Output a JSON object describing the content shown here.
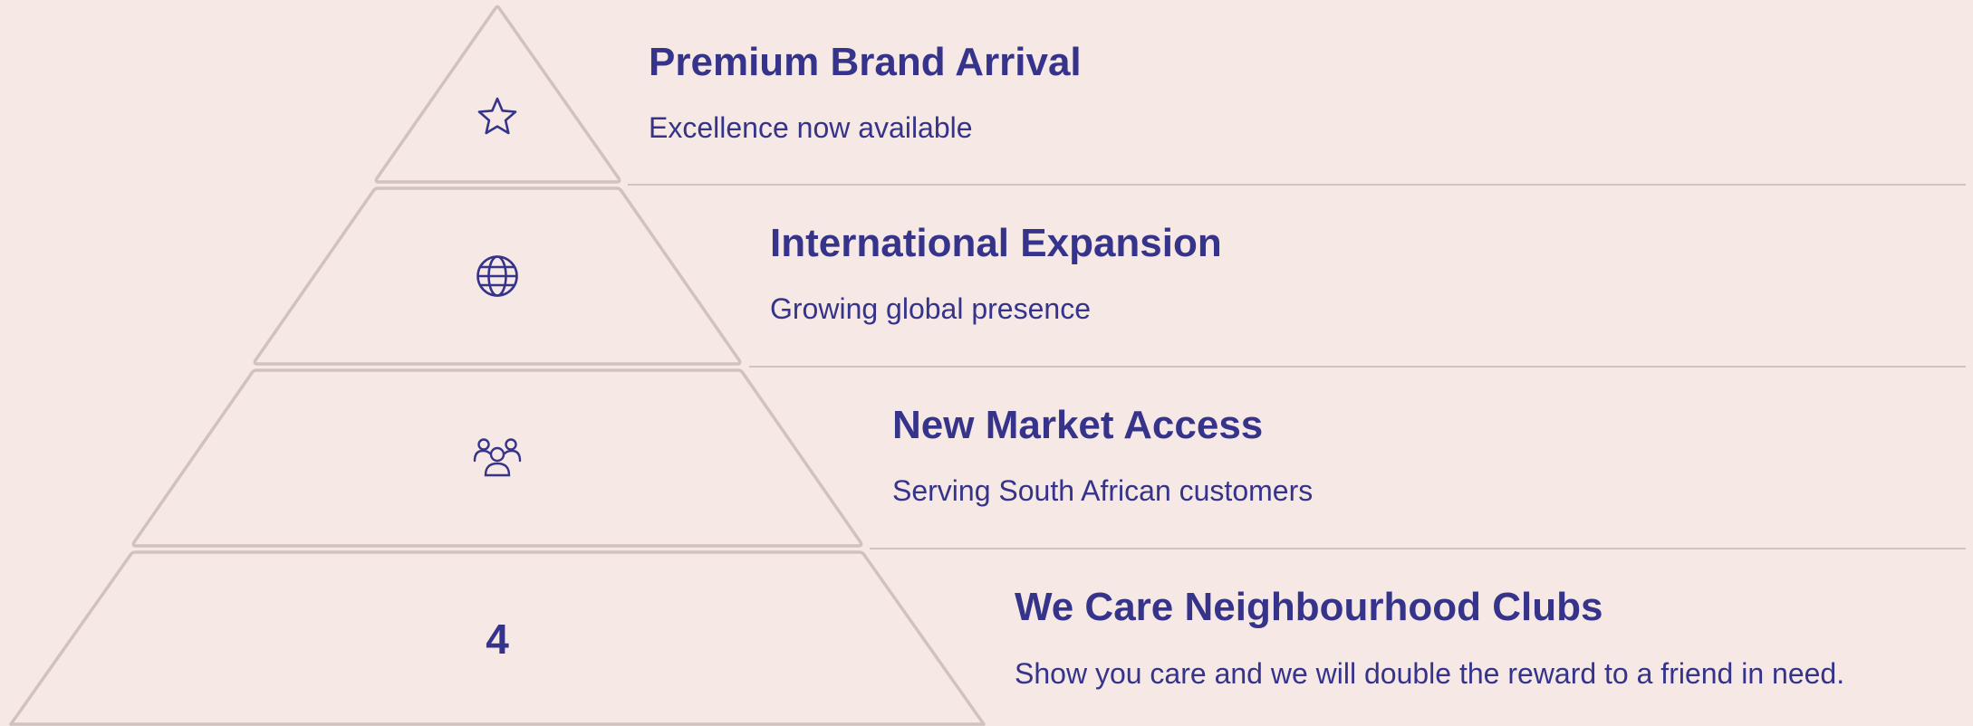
{
  "colors": {
    "background": "#F5E8E5",
    "outline": "#D2C1BC",
    "text": "#35338A"
  },
  "tiers": [
    {
      "title": "Premium Brand Arrival",
      "subtitle": "Excellence now available",
      "icon": "star-icon"
    },
    {
      "title": "International Expansion",
      "subtitle": "Growing global presence",
      "icon": "globe-icon"
    },
    {
      "title": "New Market Access",
      "subtitle": "Serving South African customers",
      "icon": "users-icon"
    },
    {
      "title": "We Care Neighbourhood Clubs",
      "subtitle": "Show you care and we will double the reward to a friend in need.",
      "number": "4"
    }
  ]
}
